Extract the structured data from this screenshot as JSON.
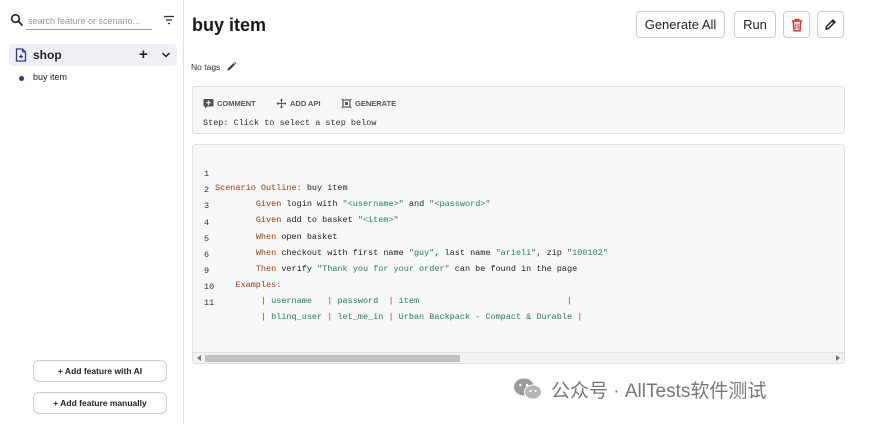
{
  "sidebar": {
    "search": {
      "placeholder": "search feature or scenario..."
    },
    "feature": {
      "name": "shop",
      "add_symbol": "+"
    },
    "scenarios": [
      {
        "name": "buy item"
      }
    ],
    "buttons": {
      "add_ai": "+ Add feature with AI",
      "add_manual": "+ Add feature manually"
    }
  },
  "main": {
    "title": "buy item",
    "actions": {
      "generate_all": "Generate All",
      "run": "Run"
    },
    "tags_text": "No tags",
    "step_toolbar": {
      "comment": "COMMENT",
      "add_api": "ADD API",
      "generate": "GENERATE",
      "hint": "Step: Click to select a step below"
    }
  },
  "code": {
    "lines": [
      {
        "num": "1",
        "indent": "",
        "kw": "Scenario Outline:",
        "rest": " buy item"
      },
      {
        "num": "2",
        "indent": "        ",
        "kw": "Given",
        "p1": " login with ",
        "s1": "\"<username>\"",
        "p2": " and ",
        "s2": "\"<password>\""
      },
      {
        "num": "3",
        "indent": "        ",
        "kw": "Given",
        "p1": " add to basket ",
        "s1": "\"<item>\""
      },
      {
        "num": "4",
        "indent": "        ",
        "kw": "When",
        "p1": " open basket"
      },
      {
        "num": "5",
        "indent": "        ",
        "kw": "When",
        "p1": " checkout with first name ",
        "s1": "\"guy\"",
        "p2": ", last name ",
        "s2": "\"arieli\"",
        "p3": ", zip ",
        "s3": "\"100102\""
      },
      {
        "num": "6",
        "indent": "        ",
        "kw": "Then",
        "p1": " verify ",
        "s1": "\"Thank you for your order\"",
        "p2": " can be found in the page"
      },
      {
        "num": "9",
        "indent": "    ",
        "kw": "Examples:"
      },
      {
        "num": "10",
        "cells": [
          "username   ",
          "password  ",
          "item                            "
        ]
      },
      {
        "num": "11",
        "cells": [
          "blinq_user ",
          "let_me_in ",
          "Urban Backpack - Compact & Durable"
        ]
      }
    ]
  },
  "watermark": {
    "text": "公众号 · AllTests软件测试"
  },
  "colors": {
    "keyword": "#9b3b12",
    "string": "#2e7d55",
    "delete": "#d32f2f",
    "accent": "#2b3a8f"
  }
}
